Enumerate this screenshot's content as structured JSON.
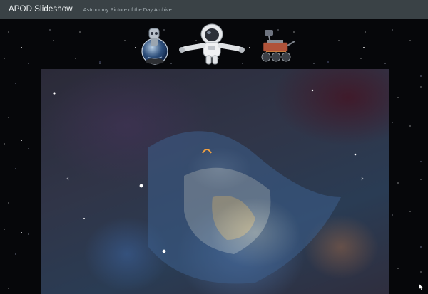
{
  "app": {
    "brand": "APOD Slideshow",
    "subtitle": "Astronomy Picture of the Day Archive"
  },
  "mascots": [
    {
      "name": "robot-in-globe",
      "icon": "robot-globe-icon"
    },
    {
      "name": "astronaut",
      "icon": "astronaut-icon"
    },
    {
      "name": "mars-rover",
      "icon": "rover-icon"
    }
  ],
  "slideshow": {
    "prev_icon": "chevron-left-icon",
    "next_icon": "chevron-right-icon",
    "prev_glyph": "‹",
    "next_glyph": "›"
  },
  "colors": {
    "navbar": "#3a4246",
    "background": "#06070a"
  }
}
